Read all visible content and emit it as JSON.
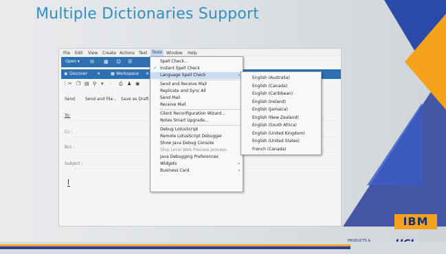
{
  "slide": {
    "title": "Multiple Dictionaries Support",
    "logo_ibm": "IBM",
    "logo_hcl": "HCL",
    "products_label": "PRODUCTS & PLATFORMS",
    "colors": {
      "title": "#2f8fc2",
      "accent_orange": "#f4a21b",
      "accent_blue": "#2c3f9a"
    }
  },
  "app": {
    "menubar": [
      "File",
      "Edit",
      "View",
      "Create",
      "Actions",
      "Text",
      "Tools",
      "Window",
      "Help"
    ],
    "active_menu": "Tools",
    "toolbar": {
      "open_label": "Open ▾"
    },
    "tabs": [
      {
        "label": "Discover",
        "icon": "compass-icon"
      },
      {
        "label": "Workspace",
        "icon": "grid-icon"
      }
    ],
    "actions": [
      "Send",
      "Send and File...",
      "Save as Draft"
    ],
    "fields": [
      {
        "label": "To:"
      },
      {
        "label": "Cc :"
      },
      {
        "label": "Bcc :"
      },
      {
        "label": "Subject :"
      }
    ],
    "tools_menu": [
      {
        "label": "Spell Check..."
      },
      {
        "label": "Instant Spell Check",
        "checked": true
      },
      {
        "label": "Language Spell Check",
        "submenu": true,
        "highlighted": true
      },
      {
        "sep": true
      },
      {
        "label": "Send and Receive Mail"
      },
      {
        "label": "Replicate and Sync All"
      },
      {
        "label": "Send Mail"
      },
      {
        "label": "Receive Mail"
      },
      {
        "sep": true
      },
      {
        "label": "Client Reconfiguration Wizard..."
      },
      {
        "label": "Notes Smart Upgrade..."
      },
      {
        "sep": true
      },
      {
        "label": "Debug LotusScript"
      },
      {
        "label": "Remote LotusScript Debugger"
      },
      {
        "label": "Show Java Debug Console"
      },
      {
        "label": "Stop Local Web Preview process",
        "disabled": true
      },
      {
        "label": "Java Debugging Preferences"
      },
      {
        "label": "Widgets",
        "submenu": true
      },
      {
        "label": "Business Card",
        "submenu": true
      }
    ],
    "language_submenu": [
      "English (Australia)",
      "English (Canada)",
      "English (Caribbean)",
      "English (Ireland)",
      "English (Jamaica)",
      "English (New Zealand)",
      "English (South Africa)",
      "English (United Kingdom)",
      "English (United States)",
      "French (Canada)"
    ]
  }
}
